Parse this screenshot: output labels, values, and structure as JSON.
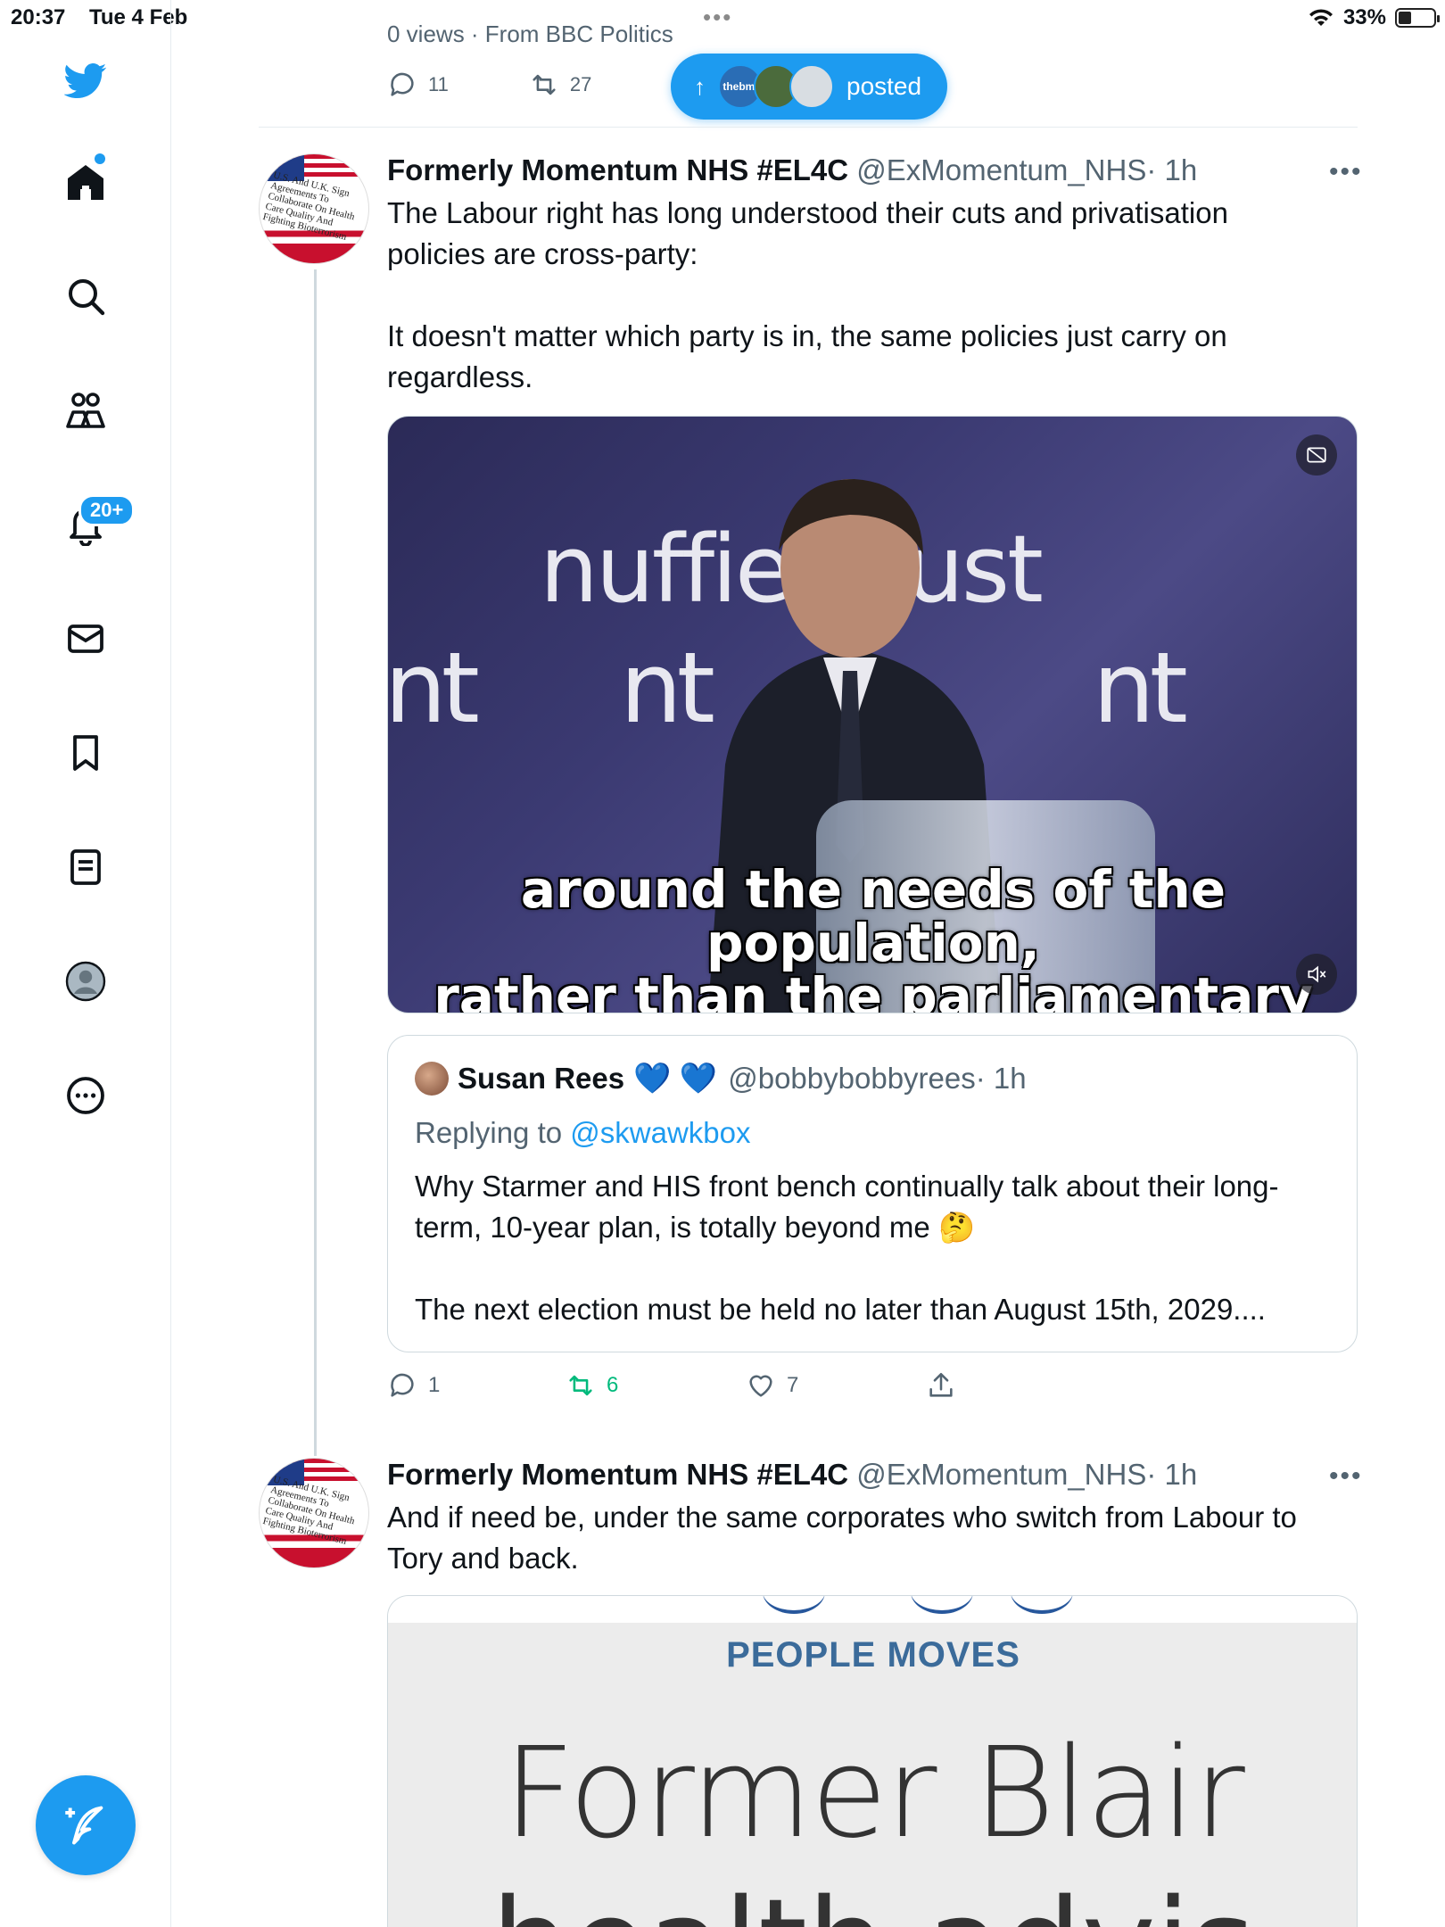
{
  "status_bar": {
    "time": "20:37",
    "date": "Tue 4 Feb",
    "battery": "33%"
  },
  "sidebar": {
    "notifications_badge": "20+",
    "items": [
      "home",
      "explore",
      "communities",
      "notifications",
      "messages",
      "bookmarks",
      "lists",
      "profile",
      "more"
    ]
  },
  "previous_tweet": {
    "faded_text": "0 views · From BBC Politics",
    "replies": "11",
    "retweets": "27"
  },
  "new_posts_pill": {
    "label": "posted",
    "avatar1_text": "thebmj"
  },
  "tweet1": {
    "name": "Formerly Momentum NHS #EL4C",
    "handle": "@ExMomentum_NHS",
    "time": "· 1h",
    "text": "The Labour right has long understood their cuts and privatisation policies are cross-party:\n\nIt doesn't matter which party is in, the same policies just carry on regardless.",
    "avatar_text": "U.S. And U.K. Sign Agreements To Collaborate On Health Care Quality And Fighting Bioterrorism",
    "avatar_year": "2001",
    "video": {
      "backdrop_logo": "nuffiel",
      "backdrop_logo2": "ust",
      "backdrop_mark": "nt",
      "caption_line1": "around the needs of the population,",
      "caption_line2": "rather than the parliamentary cycle."
    },
    "quote": {
      "name": "Susan Rees",
      "hearts": "💙 💙",
      "handle": "@bobbybobbyrees",
      "time": "· 1h",
      "replying_prefix": "Replying to",
      "replying_to": "@skwawkbox",
      "text": "Why Starmer and HIS front bench continually talk about their long-term, 10-year plan, is totally beyond me 🤔\n\nThe next election must be held no later than August 15th, 2029...."
    },
    "actions": {
      "replies": "1",
      "retweets": "6",
      "likes": "7"
    }
  },
  "tweet2": {
    "name": "Formerly Momentum NHS #EL4C",
    "handle": "@ExMomentum_NHS",
    "time": "· 1h",
    "text": "And if need be, under the same corporates who switch from Labour to Tory and back.",
    "avatar_text": "U.S. And U.K. Sign Agreements To Collaborate On Health Care Quality And Fighting Bioterrorism",
    "avatar_year": "2001",
    "card": {
      "kicker": "PEOPLE MOVES",
      "headline": "Former Blair",
      "headline2": "health advis"
    }
  },
  "colors": {
    "accent": "#1d9bf0",
    "retweet_active": "#00ba7c",
    "muted": "#536471",
    "border": "#cfd9de"
  }
}
